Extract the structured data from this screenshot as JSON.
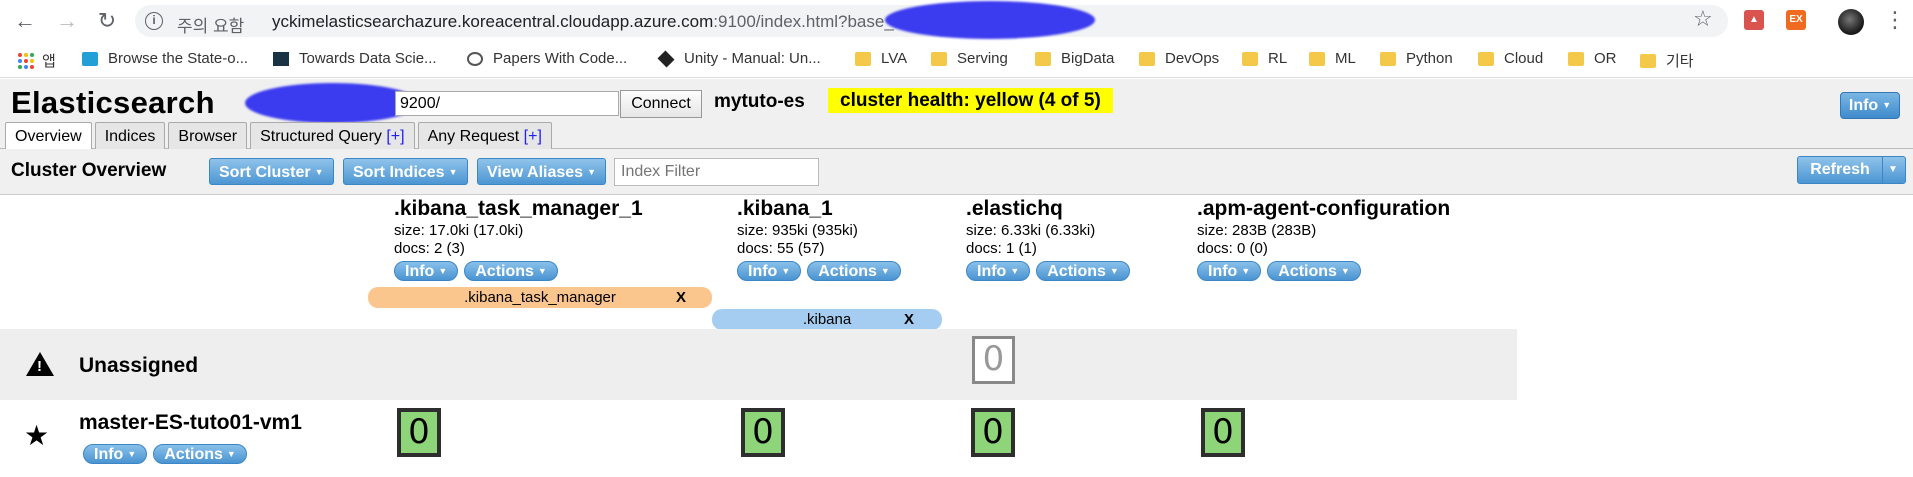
{
  "browser": {
    "url_warning": "주의 요함",
    "url_host": "yckimelasticsearchazure.koreacentral.cloudapp.azure.com",
    "url_rest": ":9100/index.html?base_u",
    "bookmarks": [
      {
        "label": "앱",
        "icon": "apps-icon"
      },
      {
        "label": "Browse the State-o...",
        "icon": "paperswithcode-icon"
      },
      {
        "label": "Towards Data Scie...",
        "icon": "towards-data-science-icon"
      },
      {
        "label": "Papers With Code...",
        "icon": "globe-icon"
      },
      {
        "label": "Unity - Manual: Un...",
        "icon": "unity-icon"
      },
      {
        "label": "LVA",
        "icon": "folder-icon"
      },
      {
        "label": "Serving",
        "icon": "folder-icon"
      },
      {
        "label": "BigData",
        "icon": "folder-icon"
      },
      {
        "label": "DevOps",
        "icon": "folder-icon"
      },
      {
        "label": "RL",
        "icon": "folder-icon"
      },
      {
        "label": "ML",
        "icon": "folder-icon"
      },
      {
        "label": "Python",
        "icon": "folder-icon"
      },
      {
        "label": "Cloud",
        "icon": "folder-icon"
      },
      {
        "label": "OR",
        "icon": "folder-icon"
      },
      {
        "label": "기타",
        "icon": "folder-icon"
      }
    ]
  },
  "header": {
    "logo": "Elasticsearch",
    "url_value": "9200/",
    "connect_label": "Connect",
    "cluster_name": "mytuto-es",
    "health": "cluster health: yellow (4 of 5)",
    "health_color": "#ffff00",
    "info_label": "Info"
  },
  "tabs": [
    {
      "label": "Overview",
      "plus": ""
    },
    {
      "label": "Indices",
      "plus": ""
    },
    {
      "label": "Browser",
      "plus": ""
    },
    {
      "label": "Structured Query ",
      "plus": "[+]"
    },
    {
      "label": "Any Request ",
      "plus": "[+]"
    }
  ],
  "toolbar": {
    "title": "Cluster Overview",
    "sort_cluster": "Sort Cluster",
    "sort_indices": "Sort Indices",
    "view_aliases": "View Aliases",
    "filter_placeholder": "Index Filter",
    "refresh": "Refresh"
  },
  "indices": [
    {
      "name": ".kibana_task_manager_1",
      "size": "size: 17.0ki (17.0ki)",
      "docs": "docs: 2 (3)",
      "info": "Info",
      "actions": "Actions",
      "alias": ".kibana_task_manager",
      "alias_close": "X",
      "alias_color": "#fbc58e",
      "node_shard": "0",
      "unassigned_shard": ""
    },
    {
      "name": ".kibana_1",
      "size": "size: 935ki (935ki)",
      "docs": "docs: 55 (57)",
      "info": "Info",
      "actions": "Actions",
      "alias": ".kibana",
      "alias_close": "X",
      "alias_color": "#a5cdf1",
      "node_shard": "0",
      "unassigned_shard": ""
    },
    {
      "name": ".elastichq",
      "size": "size: 6.33ki (6.33ki)",
      "docs": "docs: 1 (1)",
      "info": "Info",
      "actions": "Actions",
      "alias": "",
      "alias_close": "",
      "alias_color": "",
      "node_shard": "0",
      "unassigned_shard": "0"
    },
    {
      "name": ".apm-agent-configuration",
      "size": "size: 283B (283B)",
      "docs": "docs: 0 (0)",
      "info": "Info",
      "actions": "Actions",
      "alias": "",
      "alias_close": "",
      "alias_color": "",
      "node_shard": "0",
      "unassigned_shard": ""
    }
  ],
  "rows": {
    "unassigned_label": "Unassigned",
    "node_name": "master-ES-tuto01-vm1",
    "node_info": "Info",
    "node_actions": "Actions"
  }
}
